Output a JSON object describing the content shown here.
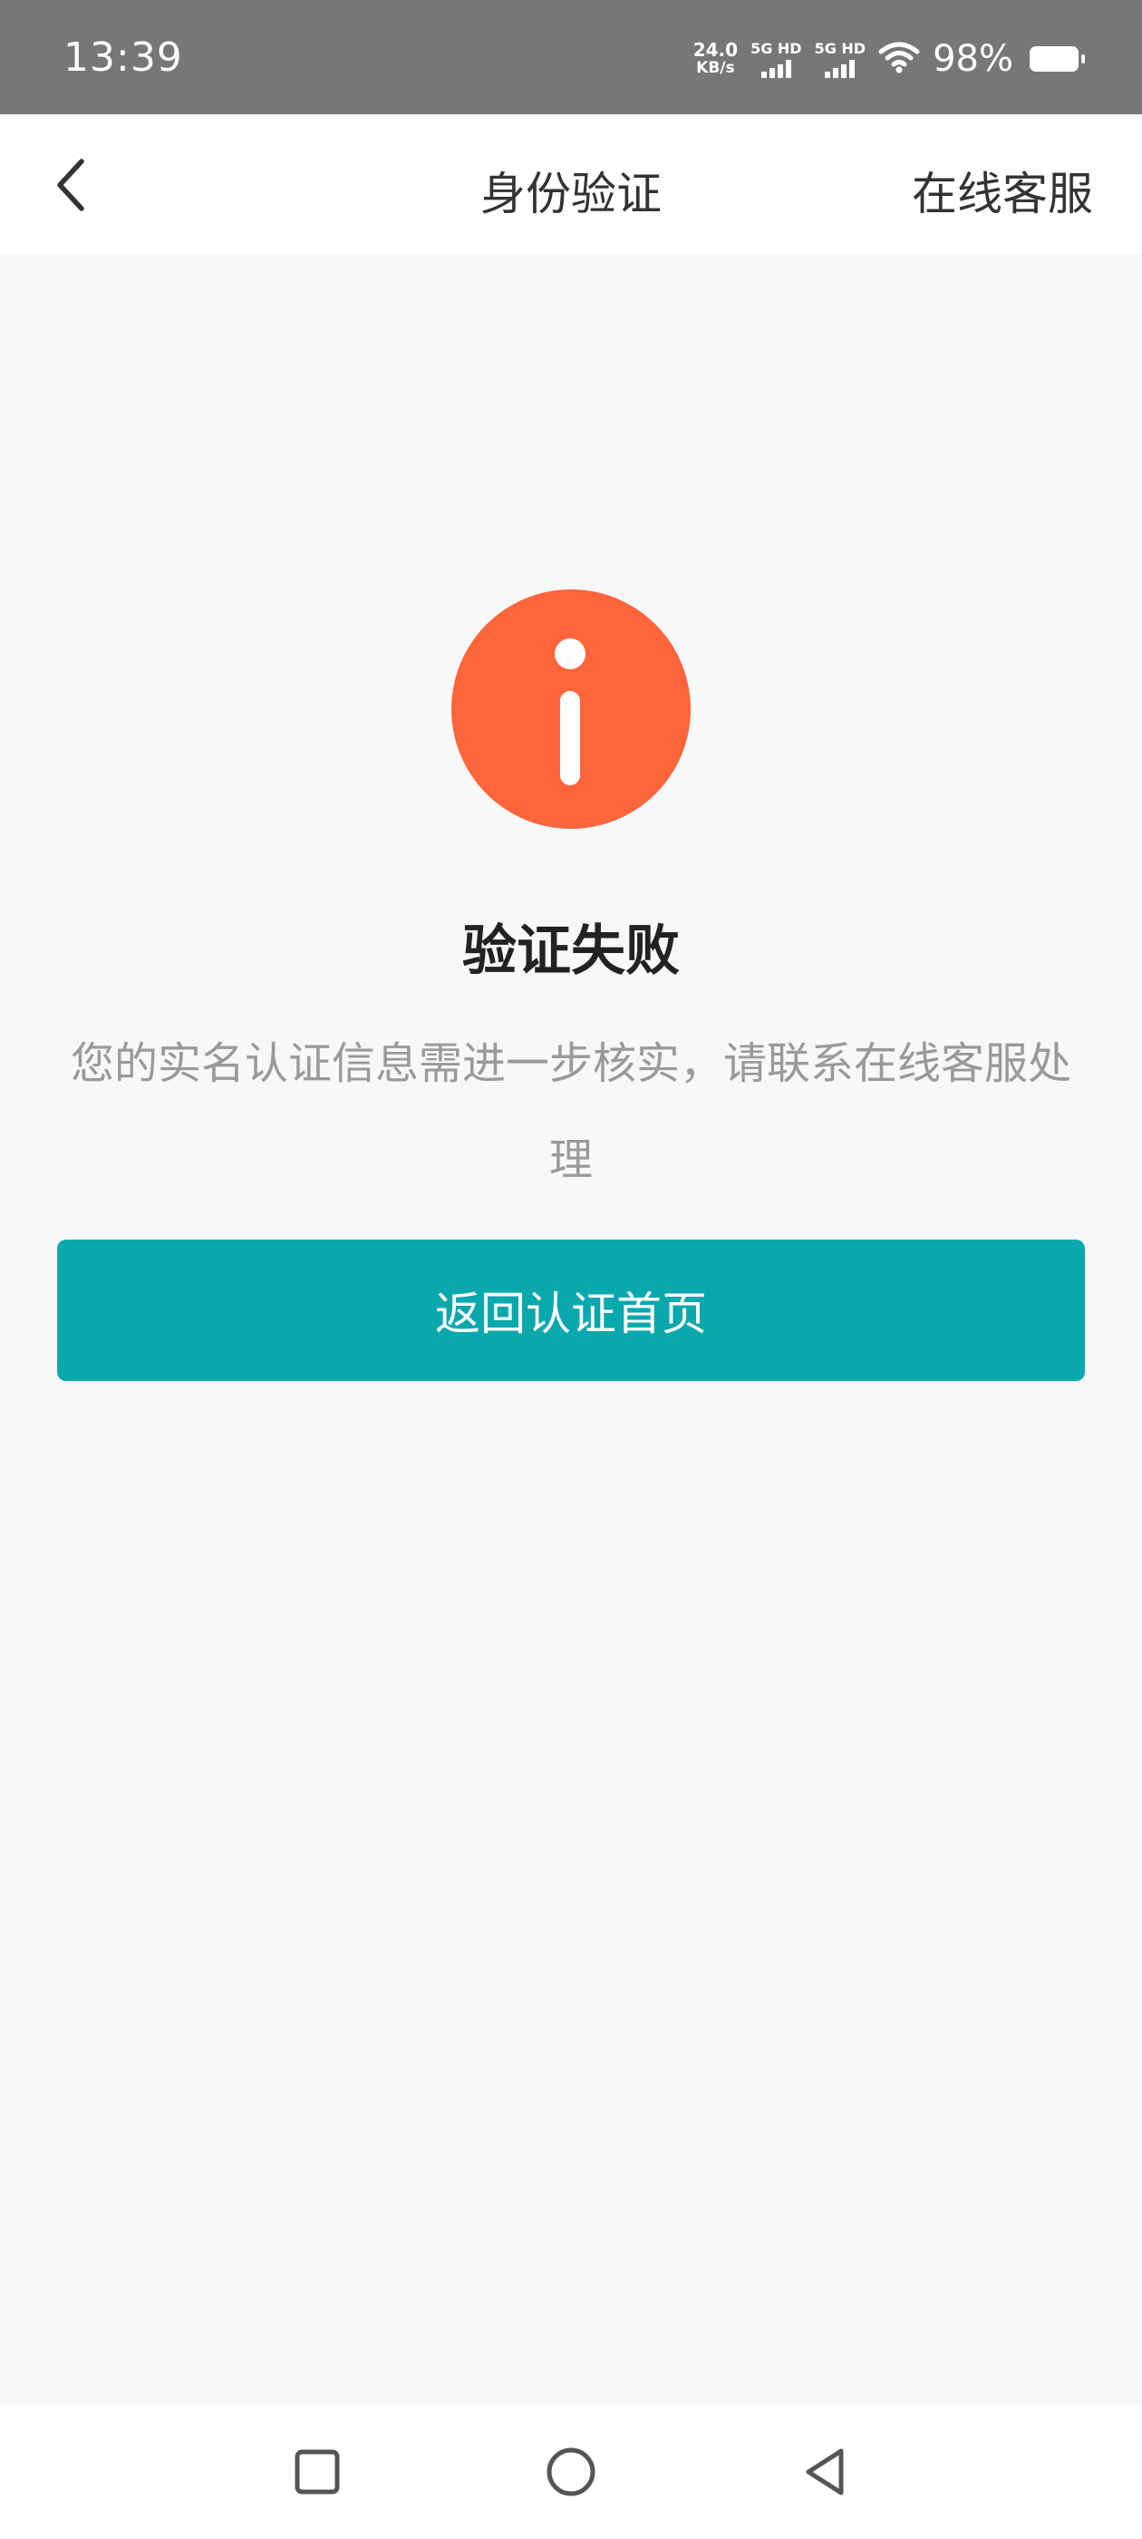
{
  "status_bar": {
    "time": "13:39",
    "net_speed_value": "24.0",
    "net_speed_unit": "KB/s",
    "sim1_label": "5G HD",
    "sim2_label": "5G HD",
    "battery_text": "98%",
    "icons": [
      "wifi-icon",
      "battery-icon",
      "signal-icon"
    ]
  },
  "nav": {
    "back_icon": "chevron-left-icon",
    "title": "身份验证",
    "service_label": "在线客服"
  },
  "result": {
    "icon": "info-icon",
    "icon_color": "#ff653b",
    "title": "验证失败",
    "description": "您的实名认证信息需进一步核实，请联系在线客服处理"
  },
  "actions": {
    "return_label": "返回认证首页",
    "accent_color": "#08a8ad"
  },
  "system_nav": {
    "icons": [
      "recent-apps-icon",
      "home-icon",
      "back-triangle-icon"
    ]
  }
}
